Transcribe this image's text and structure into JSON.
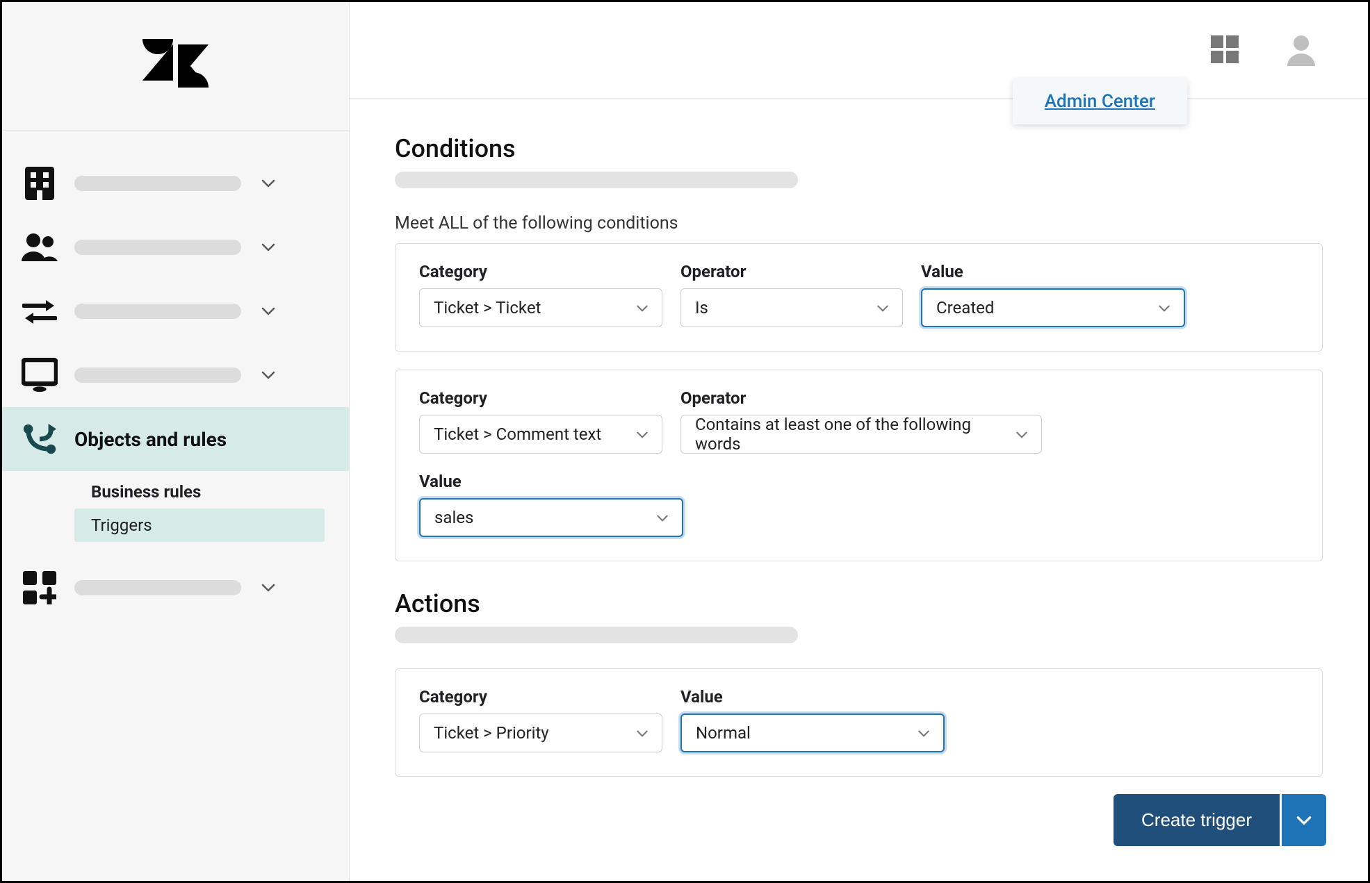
{
  "topbar": {
    "badge_label": "Admin Center"
  },
  "sidebar": {
    "active_label": "Objects and rules",
    "sub": {
      "heading": "Business rules",
      "item": "Triggers"
    }
  },
  "sections": {
    "conditions_title": "Conditions",
    "conditions_sub": "Meet ALL of the following conditions",
    "actions_title": "Actions"
  },
  "labels": {
    "category": "Category",
    "operator": "Operator",
    "value": "Value"
  },
  "condition1": {
    "category": "Ticket > Ticket",
    "operator": "Is",
    "value": "Created"
  },
  "condition2": {
    "category": "Ticket > Comment text",
    "operator": "Contains at least one of the following words",
    "value": "sales"
  },
  "action1": {
    "category": "Ticket > Priority",
    "value": "Normal"
  },
  "footer": {
    "create_label": "Create trigger"
  }
}
